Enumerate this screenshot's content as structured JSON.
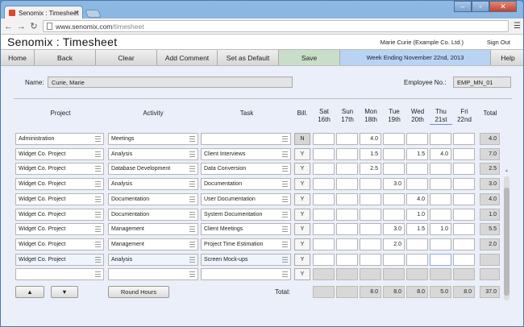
{
  "browser": {
    "tab_title": "Senomix : Timesheet",
    "url_host": "www.senomix.com",
    "url_path": "/timesheet"
  },
  "app": {
    "title": "Senomix : Timesheet",
    "user": "Marie Curie  (Example Co. Ltd.)",
    "sign_out": "Sign Out"
  },
  "toolbar": {
    "home": "Home",
    "back": "Back",
    "clear": "Clear",
    "add_comment": "Add Comment",
    "set_default": "Set as Default",
    "save": "Save",
    "week_ending": "Week Ending November 22nd, 2013",
    "help": "Help"
  },
  "employee": {
    "name_label": "Name:",
    "name": "Curie, Marie",
    "number_label": "Employee No.:",
    "number": "EMP_MN_01"
  },
  "columns": {
    "project": "Project",
    "activity": "Activity",
    "task": "Task",
    "bill": "Bill.",
    "total": "Total",
    "days": [
      {
        "name": "Sat",
        "date": "16th"
      },
      {
        "name": "Sun",
        "date": "17th"
      },
      {
        "name": "Mon",
        "date": "18th"
      },
      {
        "name": "Tue",
        "date": "19th"
      },
      {
        "name": "Wed",
        "date": "20th"
      },
      {
        "name": "Thu",
        "date": "21st"
      },
      {
        "name": "Fri",
        "date": "22nd"
      }
    ]
  },
  "rows": [
    {
      "project": "Administration",
      "activity": "Meetings",
      "task": "",
      "bill": "N",
      "hours": [
        "",
        "",
        "4.0",
        "",
        "",
        "",
        ""
      ],
      "total": "4.0"
    },
    {
      "project": "Widget Co. Project",
      "activity": "Analysis",
      "task": "Client Interviews",
      "bill": "Y",
      "hours": [
        "",
        "",
        "1.5",
        "",
        "1.5",
        "4.0",
        ""
      ],
      "total": "7.0"
    },
    {
      "project": "Widget Co. Project",
      "activity": "Database Development",
      "task": "Data Conversion",
      "bill": "Y",
      "hours": [
        "",
        "",
        "2.5",
        "",
        "",
        "",
        ""
      ],
      "total": "2.5"
    },
    {
      "project": "Widget Co. Project",
      "activity": "Analysis",
      "task": "Documentation",
      "bill": "Y",
      "hours": [
        "",
        "",
        "",
        "3.0",
        "",
        "",
        ""
      ],
      "total": "3.0"
    },
    {
      "project": "Widget Co. Project",
      "activity": "Documentation",
      "task": "User Documentation",
      "bill": "Y",
      "hours": [
        "",
        "",
        "",
        "",
        "4.0",
        "",
        ""
      ],
      "total": "4.0"
    },
    {
      "project": "Widget Co. Project",
      "activity": "Documentation",
      "task": "System Documentation",
      "bill": "Y",
      "hours": [
        "",
        "",
        "",
        "",
        "1.0",
        "",
        ""
      ],
      "total": "1.0"
    },
    {
      "project": "Widget Co. Project",
      "activity": "Management",
      "task": "Client Meetings",
      "bill": "Y",
      "hours": [
        "",
        "",
        "",
        "3.0",
        "1.5",
        "1.0",
        ""
      ],
      "total": "5.5"
    },
    {
      "project": "Widget Co. Project",
      "activity": "Management",
      "task": "Project Time Estimation",
      "bill": "Y",
      "hours": [
        "",
        "",
        "",
        "2.0",
        "",
        "",
        ""
      ],
      "total": "2.0"
    },
    {
      "project": "Widget Co. Project",
      "activity": "Analysis",
      "task": "Screen Mock-ups",
      "bill": "Y",
      "hours": [
        "",
        "",
        "",
        "",
        "",
        "",
        ""
      ],
      "total": ""
    },
    {
      "project": "",
      "activity": "",
      "task": "",
      "bill": "Y",
      "hours": [
        "",
        "",
        "",
        "",
        "",
        "",
        ""
      ],
      "total": ""
    }
  ],
  "footer": {
    "move_up": "▲",
    "move_down": "▼",
    "round_hours": "Round Hours",
    "total_label": "Total:",
    "day_totals": [
      "",
      "",
      "8.0",
      "8.0",
      "8.0",
      "5.0",
      "8.0"
    ],
    "grand_total": "37.0"
  }
}
